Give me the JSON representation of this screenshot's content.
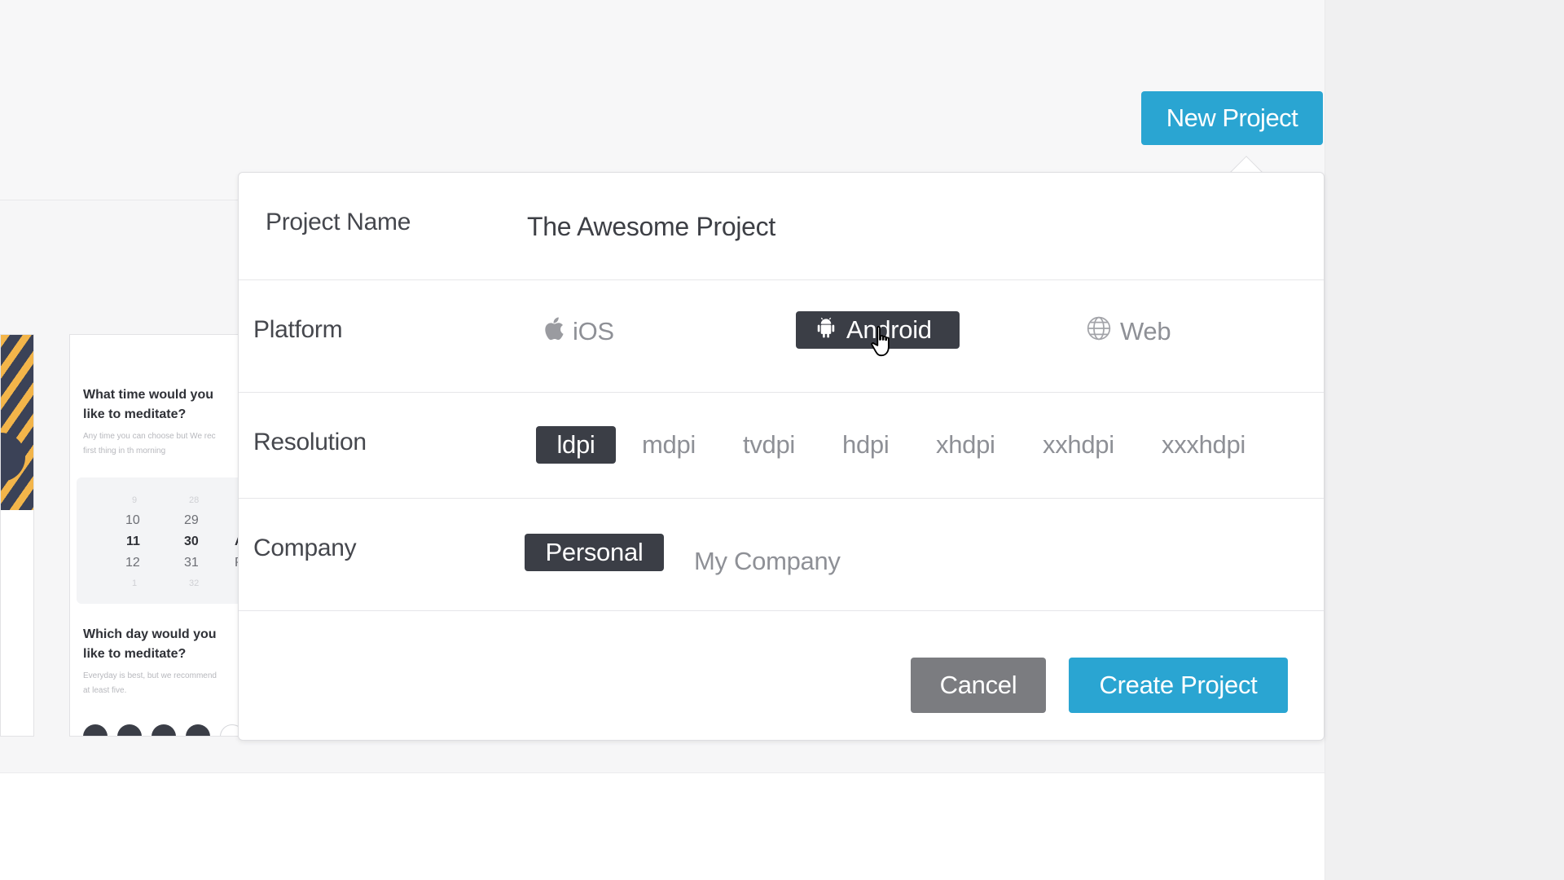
{
  "header": {
    "new_project_label": "New Project"
  },
  "thumbnail": {
    "question1": "What time would you like to meditate?",
    "sub1": "Any time you can choose but We rec",
    "sub1b": "first thing in th morning",
    "picker": {
      "col1": [
        "10",
        "11",
        "12"
      ],
      "col2": [
        "29",
        "30",
        "31"
      ],
      "col3": [
        "A",
        "P"
      ]
    },
    "question2": "Which day would you like to meditate?",
    "sub2": "Everyday is best, but we recommend",
    "sub2b": "at least five."
  },
  "form": {
    "project_name": {
      "label": "Project Name",
      "value": "The Awesome Project"
    },
    "platform": {
      "label": "Platform",
      "options": [
        {
          "label": "iOS",
          "icon": "apple-icon",
          "selected": false
        },
        {
          "label": "Android",
          "icon": "android-icon",
          "selected": true
        },
        {
          "label": "Web",
          "icon": "globe-icon",
          "selected": false
        }
      ]
    },
    "resolution": {
      "label": "Resolution",
      "options": [
        {
          "label": "ldpi",
          "selected": true
        },
        {
          "label": "mdpi",
          "selected": false
        },
        {
          "label": "tvdpi",
          "selected": false
        },
        {
          "label": "hdpi",
          "selected": false
        },
        {
          "label": "xhdpi",
          "selected": false
        },
        {
          "label": "xxhdpi",
          "selected": false
        },
        {
          "label": "xxxhdpi",
          "selected": false
        }
      ]
    },
    "company": {
      "label": "Company",
      "options": [
        {
          "label": "Personal",
          "selected": true
        },
        {
          "label": "My Company",
          "selected": false
        }
      ]
    },
    "cancel_label": "Cancel",
    "create_label": "Create Project"
  },
  "colors": {
    "accent": "#2aa5d2",
    "selected_chip": "#3b3e46",
    "cancel": "#7b7c80"
  }
}
